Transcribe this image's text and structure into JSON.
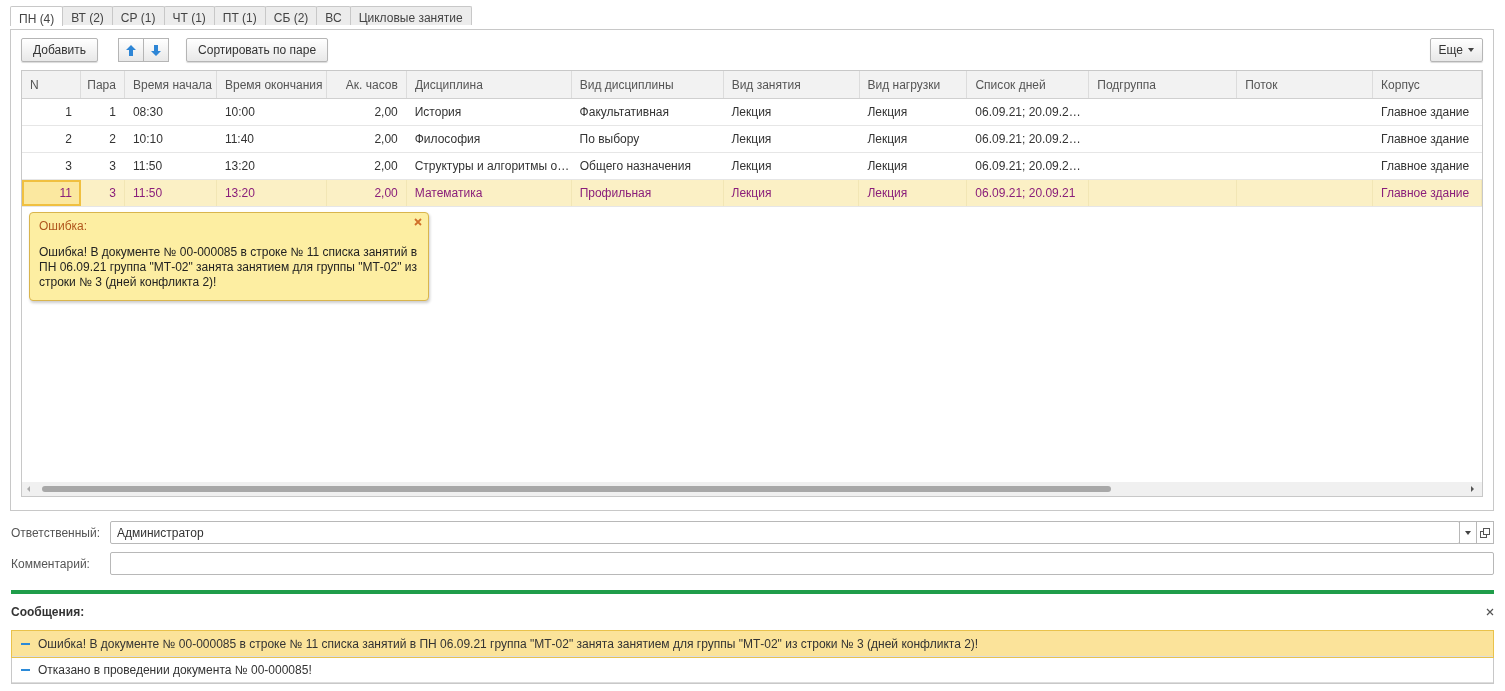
{
  "tabs": [
    {
      "label": "ПН (4)",
      "selected": true
    },
    {
      "label": "ВТ (2)",
      "selected": false
    },
    {
      "label": "СР (1)",
      "selected": false
    },
    {
      "label": "ЧТ (1)",
      "selected": false
    },
    {
      "label": "ПТ (1)",
      "selected": false
    },
    {
      "label": "СБ (2)",
      "selected": false
    },
    {
      "label": "ВС",
      "selected": false
    },
    {
      "label": "Цикловые занятие",
      "selected": false
    }
  ],
  "toolbar": {
    "add_button": "Добавить",
    "sort_button": "Сортировать по паре",
    "more_button": "Еще"
  },
  "table": {
    "columns": [
      {
        "label": "N",
        "kind": "number"
      },
      {
        "label": "Пара",
        "kind": "number"
      },
      {
        "label": "Время начала",
        "kind": "text"
      },
      {
        "label": "Время окончания",
        "kind": "text"
      },
      {
        "label": "Ак. часов",
        "kind": "number"
      },
      {
        "label": "Дисциплина",
        "kind": "text"
      },
      {
        "label": "Вид дисциплины",
        "kind": "text"
      },
      {
        "label": "Вид занятия",
        "kind": "text"
      },
      {
        "label": "Вид нагрузки",
        "kind": "text"
      },
      {
        "label": "Список дней",
        "kind": "text"
      },
      {
        "label": "Подгруппа",
        "kind": "text"
      },
      {
        "label": "Поток",
        "kind": "text"
      },
      {
        "label": "Корпус",
        "kind": "text"
      }
    ],
    "rows": [
      {
        "selected": false,
        "cells": [
          "1",
          "1",
          "08:30",
          "10:00",
          "2,00",
          "История",
          "Факультативная",
          "Лекция",
          "Лекция",
          "06.09.21; 20.09.2…",
          "",
          "",
          "Главное здание"
        ]
      },
      {
        "selected": false,
        "cells": [
          "2",
          "2",
          "10:10",
          "11:40",
          "2,00",
          "Философия",
          "По выбору",
          "Лекция",
          "Лекция",
          "06.09.21; 20.09.2…",
          "",
          "",
          "Главное здание"
        ]
      },
      {
        "selected": false,
        "cells": [
          "3",
          "3",
          "11:50",
          "13:20",
          "2,00",
          "Структуры и алгоритмы о…",
          "Общего назначения",
          "Лекция",
          "Лекция",
          "06.09.21; 20.09.2…",
          "",
          "",
          "Главное здание"
        ]
      },
      {
        "selected": true,
        "cells": [
          "11",
          "3",
          "11:50",
          "13:20",
          "2,00",
          "Математика",
          "Профильная",
          "Лекция",
          "Лекция",
          "06.09.21; 20.09.21",
          "",
          "",
          "Главное здание"
        ]
      }
    ]
  },
  "error_tooltip": {
    "title": "Ошибка:",
    "text": "Ошибка! В документе № 00-000085 в строке № 11 списка занятий в ПН 06.09.21 группа \"МТ-02\" занята занятием для группы \"МТ-02\" из строки № 3 (дней конфликта 2)!"
  },
  "fields": [
    {
      "label": "Ответственный:",
      "value": "Администратор",
      "kind": "select"
    },
    {
      "label": "Комментарий:",
      "kind": "text"
    }
  ],
  "messages": {
    "title": "Сообщения:",
    "items": [
      {
        "text": "Ошибка! В документе № 00-000085 в строке № 11 списка занятий в ПН 06.09.21 группа \"МТ-02\" занята занятием для группы \"МТ-02\" из строки № 3 (дней конфликта 2)!",
        "selected": true
      },
      {
        "text": "Отказано в проведении документа № 00-000085!",
        "selected": false
      }
    ]
  }
}
